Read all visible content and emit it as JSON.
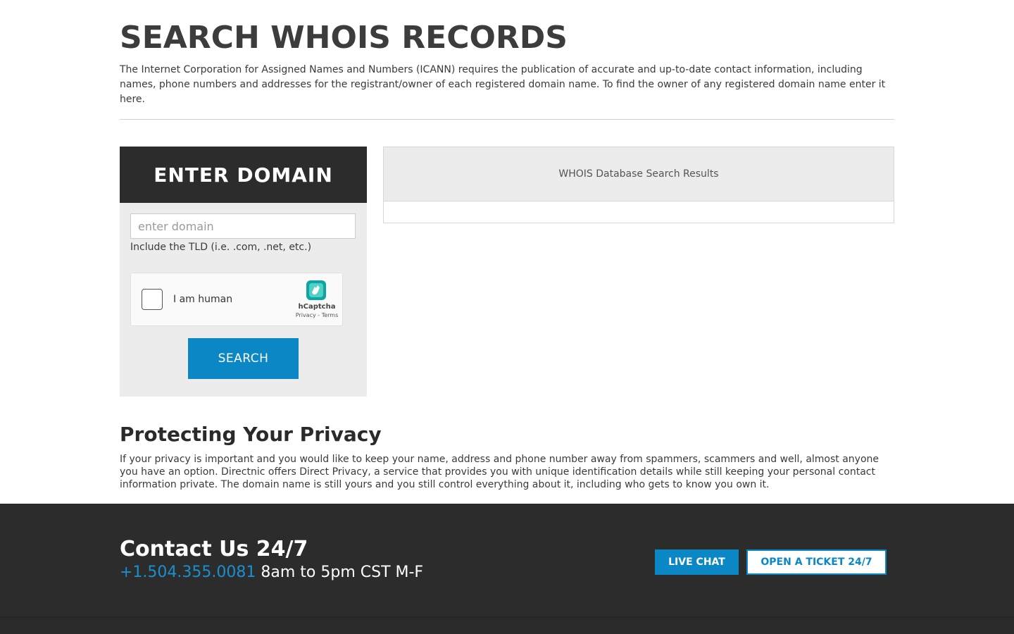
{
  "header": {
    "title": "SEARCH WHOIS RECORDS",
    "intro": "The Internet Corporation for Assigned Names and Numbers (ICANN) requires the publication of accurate and up-to-date contact information, including names, phone numbers and addresses for the registrant/owner of each registered domain name. To find the owner of any registered domain name enter it here."
  },
  "search": {
    "heading": "ENTER DOMAIN",
    "input_placeholder": "enter domain",
    "input_value": "",
    "hint": "Include the TLD (i.e. .com, .net, etc.)",
    "captcha": {
      "label": "I am human",
      "brand": "hCaptcha",
      "links": "Privacy - Terms",
      "logo_icon": "hcaptcha-logo-icon"
    },
    "button_label": "SEARCH"
  },
  "results": {
    "heading": "WHOIS Database Search Results"
  },
  "privacy": {
    "title": "Protecting Your Privacy",
    "text": "If your privacy is important and you would like to keep your name, address and phone number away from spammers, scammers and well, almost anyone you have an option. Directnic offers Direct Privacy, a service that provides you with unique identification details while still keeping your personal contact information private. The domain name is still yours and you still control everything about it, including who gets to know you own it."
  },
  "footer": {
    "contact_title": "Contact Us 24/7",
    "phone": "+1.504.355.0081",
    "hours": "8am to 5pm CST M-F",
    "live_chat_label": "LIVE CHAT",
    "ticket_label": "OPEN A TICKET 24/7"
  },
  "colors": {
    "accent": "#0a87c4",
    "dark": "#2c2c2c",
    "panel": "#ececec"
  }
}
